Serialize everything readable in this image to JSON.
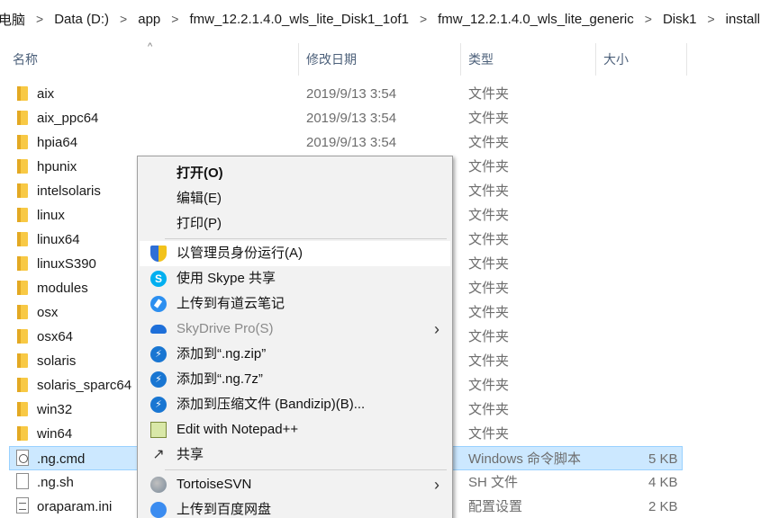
{
  "breadcrumb": [
    "电脑",
    "Data (D:)",
    "app",
    "fmw_12.2.1.4.0_wls_lite_Disk1_1of1",
    "fmw_12.2.1.4.0_wls_lite_generic",
    "Disk1",
    "install"
  ],
  "columns": {
    "name": "名称",
    "date": "修改日期",
    "type": "类型",
    "size": "大小"
  },
  "files": [
    {
      "name": "aix",
      "date": "2019/9/13 3:54",
      "type": "文件夹",
      "size": "",
      "icon": "folder-icon"
    },
    {
      "name": "aix_ppc64",
      "date": "2019/9/13 3:54",
      "type": "文件夹",
      "size": "",
      "icon": "folder-icon"
    },
    {
      "name": "hpia64",
      "date": "2019/9/13 3:54",
      "type": "文件夹",
      "size": "",
      "icon": "folder-icon"
    },
    {
      "name": "hpunix",
      "date": "",
      "type": "文件夹",
      "size": "",
      "icon": "folder-icon"
    },
    {
      "name": "intelsolaris",
      "date": "",
      "type": "文件夹",
      "size": "",
      "icon": "folder-icon"
    },
    {
      "name": "linux",
      "date": "",
      "type": "文件夹",
      "size": "",
      "icon": "folder-icon"
    },
    {
      "name": "linux64",
      "date": "",
      "type": "文件夹",
      "size": "",
      "icon": "folder-icon"
    },
    {
      "name": "linuxS390",
      "date": "",
      "type": "文件夹",
      "size": "",
      "icon": "folder-icon"
    },
    {
      "name": "modules",
      "date": "",
      "type": "文件夹",
      "size": "",
      "icon": "folder-icon"
    },
    {
      "name": "osx",
      "date": "",
      "type": "文件夹",
      "size": "",
      "icon": "folder-icon"
    },
    {
      "name": "osx64",
      "date": "",
      "type": "文件夹",
      "size": "",
      "icon": "folder-icon"
    },
    {
      "name": "solaris",
      "date": "",
      "type": "文件夹",
      "size": "",
      "icon": "folder-icon"
    },
    {
      "name": "solaris_sparc64",
      "date": "",
      "type": "文件夹",
      "size": "",
      "icon": "folder-icon"
    },
    {
      "name": "win32",
      "date": "",
      "type": "文件夹",
      "size": "",
      "icon": "folder-icon"
    },
    {
      "name": "win64",
      "date": "",
      "type": "文件夹",
      "size": "",
      "icon": "folder-icon"
    },
    {
      "name": ".ng.cmd",
      "date": "",
      "type": "Windows 命令脚本",
      "size": "5 KB",
      "icon": "cmd-file-icon",
      "selected": true
    },
    {
      "name": ".ng.sh",
      "date": "",
      "type": "SH 文件",
      "size": "4 KB",
      "icon": "file-icon"
    },
    {
      "name": "oraparam.ini",
      "date": "",
      "type": "配置设置",
      "size": "2 KB",
      "icon": "ini-file-icon"
    }
  ],
  "context_menu": {
    "items": [
      {
        "label": "打开(O)",
        "bold": true,
        "icon": ""
      },
      {
        "label": "编辑(E)",
        "icon": ""
      },
      {
        "label": "打印(P)",
        "icon": ""
      },
      {
        "label": "以管理员身份运行(A)",
        "icon": "shield-icon",
        "highlight": true
      },
      {
        "label": "使用 Skype 共享",
        "icon": "skype-icon"
      },
      {
        "label": "上传到有道云笔记",
        "icon": "youdao-note-icon"
      },
      {
        "label": "SkyDrive Pro(S)",
        "icon": "cloud-icon",
        "disabled": true,
        "submenu": true
      },
      {
        "label": "添加到“.ng.zip”",
        "icon": "bandizip-icon"
      },
      {
        "label": "添加到“.ng.7z”",
        "icon": "bandizip-icon"
      },
      {
        "label": "添加到压缩文件 (Bandizip)(B)...",
        "icon": "bandizip-icon"
      },
      {
        "label": "Edit with Notepad++",
        "icon": "notepad-plus-icon"
      },
      {
        "label": "共享",
        "icon": "share-icon"
      },
      {
        "label": "TortoiseSVN",
        "icon": "tortoisesvn-icon",
        "submenu": true
      },
      {
        "label": "上传到百度网盘",
        "icon": "baidu-netdisk-icon"
      }
    ]
  },
  "colors": {
    "selection_bg": "#cce8ff",
    "selection_border": "#99d1ff",
    "menu_bg": "#f2f2f2",
    "folder": "#f8c945"
  }
}
